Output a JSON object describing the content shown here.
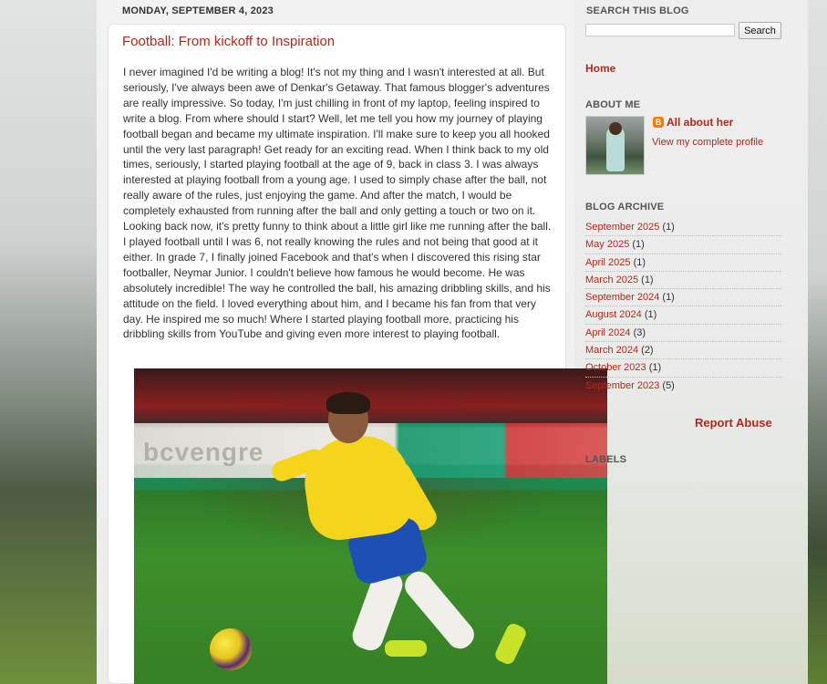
{
  "post": {
    "date": "MONDAY, SEPTEMBER 4, 2023",
    "title": "Football: From kickoff to Inspiration",
    "body": "I never imagined I'd be writing a blog! It's not my thing and I wasn't interested at all. But seriously, I've always been awe of Denkar's Getaway. That famous blogger's adventures are really impressive. So today, I'm just chilling in front of my laptop, feeling inspired to write a blog. From where should I start? Well, let me tell you how my journey of playing football began and became my ultimate inspiration. I'll make sure to keep you all hooked until the very last paragraph! Get ready for an exciting read. When I think back to my old times, seriously, I started playing football at the age of 9, back in class 3. I was always interested at playing football from a young age. I used to simply chase after the ball, not really aware of the rules, just enjoying the game. And after the match, I would be completely exhausted from running after the ball and only getting a touch or two on it. Looking back now, it's pretty funny to think about a little girl like me running after the ball. I played football until I was 6, not really knowing the rules and not being that good at it either. In grade 7, I finally joined Facebook and that's when I discovered this rising star footballer, Neymar Junior. I couldn't believe how famous he would become. He was absolutely incredible! The way he controlled the ball, his amazing dribbling skills, and his attitude on the field. I loved everything about him, and I became his fan from that very day. He inspired me so much! Where I started playing football more, practicing his dribbling skills from YouTube and giving even more interest to playing football."
  },
  "sidebar": {
    "search_heading": "SEARCH THIS BLOG",
    "search_value": "",
    "search_button": "Search",
    "home_link": "Home",
    "about_heading": "ABOUT ME",
    "profile_name": "All about her",
    "profile_link": "View my complete profile",
    "archive_heading": "BLOG ARCHIVE",
    "archive": [
      {
        "label": "September 2025",
        "count": "(1)"
      },
      {
        "label": "May 2025",
        "count": "(1)"
      },
      {
        "label": "April 2025",
        "count": "(1)"
      },
      {
        "label": "March 2025",
        "count": "(1)"
      },
      {
        "label": "September 2024",
        "count": "(1)"
      },
      {
        "label": "August 2024",
        "count": "(1)"
      },
      {
        "label": "April 2024",
        "count": "(3)"
      },
      {
        "label": "March 2024",
        "count": "(2)"
      },
      {
        "label": "October 2023",
        "count": "(1)"
      },
      {
        "label": "September 2023",
        "count": "(5)"
      }
    ],
    "report_abuse": "Report Abuse",
    "labels_heading": "LABELS"
  },
  "colors": {
    "link": "#b02a1b",
    "text": "#333333",
    "blogger_orange": "#f57d00"
  },
  "icons": {
    "blogger": "blogger-icon"
  }
}
